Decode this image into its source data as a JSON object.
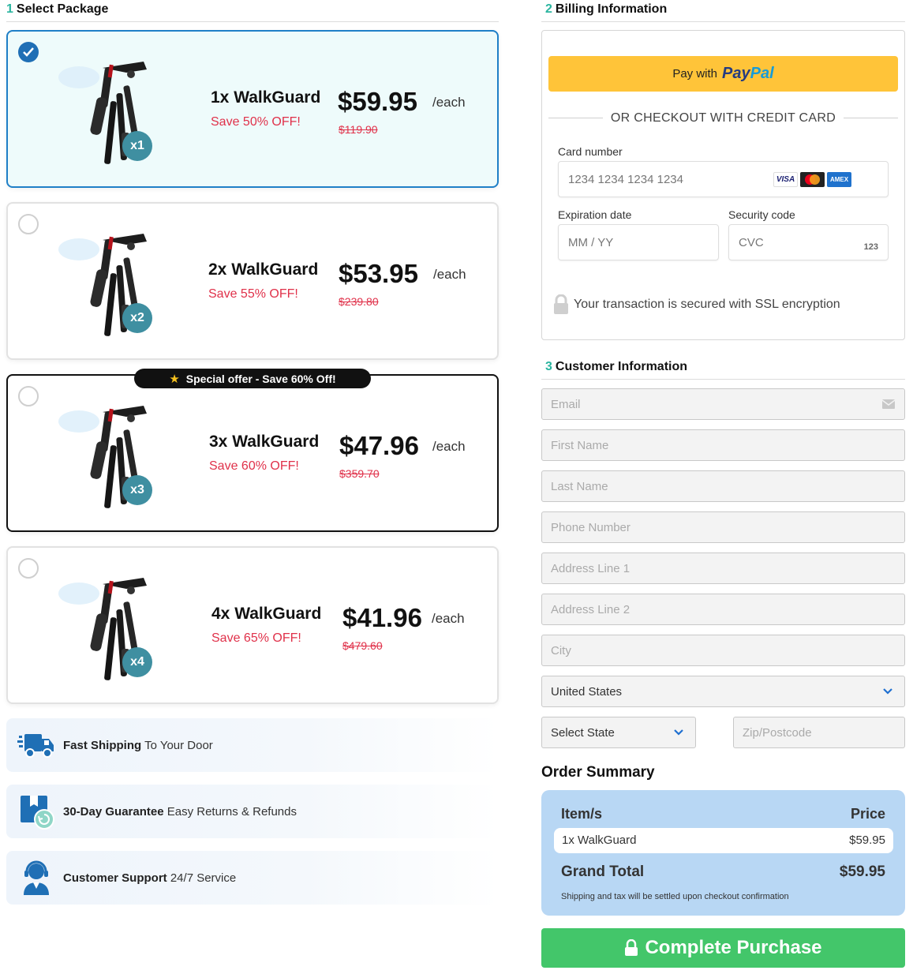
{
  "steps": {
    "package": {
      "num": "1",
      "label": "Select Package"
    },
    "billing": {
      "num": "2",
      "label": "Billing Information"
    },
    "customer": {
      "num": "3",
      "label": "Customer Information"
    }
  },
  "packages": [
    {
      "badge": "x1",
      "name": "1x WalkGuard",
      "save": "Save 50% OFF!",
      "price": "$59.95",
      "each": "/each",
      "original": "$119.90",
      "selected": true
    },
    {
      "badge": "x2",
      "name": "2x WalkGuard",
      "save": "Save 55% OFF!",
      "price": "$53.95",
      "each": "/each",
      "original": "$239.80",
      "selected": false
    },
    {
      "badge": "x3",
      "name": "3x WalkGuard",
      "save": "Save 60% OFF!",
      "price": "$47.96",
      "each": "/each",
      "original": "$359.70",
      "selected": false
    },
    {
      "badge": "x4",
      "name": "4x WalkGuard",
      "save": "Save 65% OFF!",
      "price": "$41.96",
      "each": "/each",
      "original": "$479.60",
      "selected": false
    }
  ],
  "special_offer": "Special offer - Save 60% Off!",
  "features": [
    {
      "bold": "Fast Shipping",
      "rest": "To Your Door",
      "icon": "truck-icon"
    },
    {
      "bold": "30-Day Guarantee",
      "rest": "Easy Returns & Refunds",
      "icon": "return-box-icon"
    },
    {
      "bold": "Customer Support",
      "rest": "24/7 Service",
      "icon": "headset-agent-icon"
    }
  ],
  "billing": {
    "paypal_prefix": "Pay with",
    "paypal_pay": "Pay",
    "paypal_pal": "Pal",
    "or_text": "OR CHECKOUT WITH CREDIT CARD",
    "card_number_label": "Card number",
    "card_number_placeholder": "1234 1234 1234 1234",
    "card_brands": [
      "VISA",
      "Mastercard",
      "AMEX"
    ],
    "expiry_label": "Expiration date",
    "expiry_placeholder": "MM / YY",
    "cvc_label": "Security code",
    "cvc_placeholder": "CVC",
    "cvc_hint": "123",
    "ssl_text": "Your transaction is secured with SSL encryption"
  },
  "customer": {
    "email": "Email",
    "first_name": "First Name",
    "last_name": "Last Name",
    "phone": "Phone Number",
    "address1": "Address Line 1",
    "address2": "Address Line 2",
    "city": "City",
    "country": "United States",
    "state": "Select State",
    "zip": "Zip/Postcode"
  },
  "order_summary": {
    "title": "Order Summary",
    "items_header": "Item/s",
    "price_header": "Price",
    "item_name": "1x WalkGuard",
    "item_price": "$59.95",
    "total_label": "Grand Total",
    "total_value": "$59.95",
    "note": "Shipping and tax will be settled upon checkout confirmation"
  },
  "purchase_button": "Complete Purchase",
  "colors": {
    "accent_teal": "#2bb5a0",
    "selected_border": "#1f7fc7",
    "save_red": "#e0314a",
    "paypal_yellow": "#ffc439",
    "purchase_green": "#43c66a",
    "summary_blue": "#b8d7f4",
    "badge_teal": "#3f8fa1"
  }
}
